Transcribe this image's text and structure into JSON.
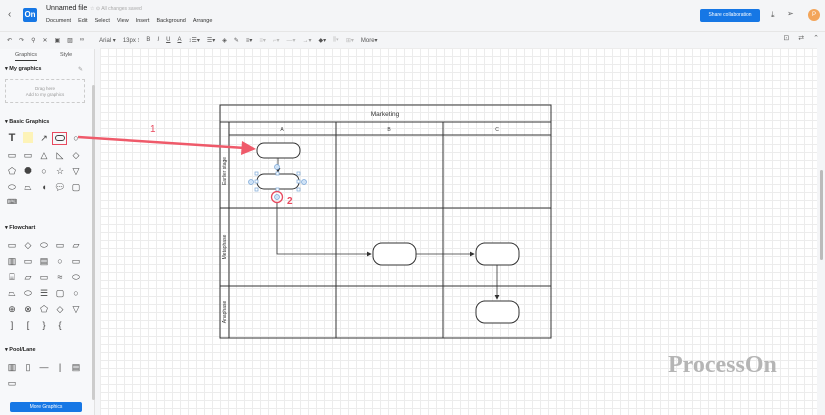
{
  "header": {
    "title": "Unnamed file",
    "saved": "All changes saved",
    "menu": [
      "Document",
      "Edit",
      "Select",
      "View",
      "Insert",
      "Background",
      "Arrange"
    ],
    "share": "Share collaboration",
    "avatar": "P"
  },
  "toolbar": {
    "font": "Arial",
    "size": "13px",
    "more": "More"
  },
  "sidebar": {
    "tabs": [
      "Graphics",
      "Style"
    ],
    "my_graphics": "My graphics",
    "drop_line1": "Drag here",
    "drop_line2": "Add to my graphics",
    "basic": "Basic Graphics",
    "flowchart": "Flowchart",
    "pool": "Pool/Lane",
    "more_button": "More Graphics"
  },
  "diagram": {
    "pool_title": "Marketing",
    "columns": [
      "A",
      "B",
      "C"
    ],
    "lanes": [
      "Earlier stage",
      "Metaphase",
      "Anaphase"
    ],
    "annotation1": "1",
    "annotation2": "2"
  },
  "watermark": "ProcessOn",
  "colors": {
    "accent": "#1677e5",
    "annotation": "#e84a5f"
  }
}
